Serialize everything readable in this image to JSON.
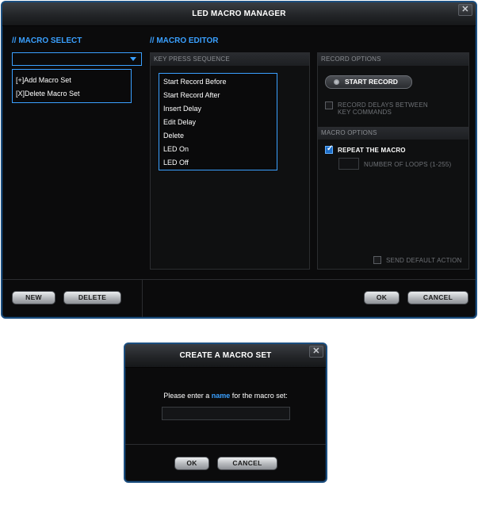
{
  "main_window": {
    "title": "LED MACRO MANAGER",
    "close_glyph": "✕",
    "macro_select": {
      "heading": "// MACRO SELECT",
      "dropdown_value": "",
      "menu_items": [
        "[+]Add Macro Set",
        "[X]Delete Macro Set"
      ]
    },
    "macro_editor": {
      "heading": "// MACRO EDITOR",
      "key_press_header": "KEY PRESS SEQUENCE",
      "sequence_items": [
        "Start Record Before",
        "Start Record After",
        "Insert Delay",
        "Edit Delay",
        "Delete",
        "LED On",
        "LED Off"
      ]
    },
    "record_options": {
      "header": "RECORD OPTIONS",
      "start_record_label": "START RECORD",
      "record_delays_line1": "RECORD DELAYS BETWEEN",
      "record_delays_line2": "KEY COMMANDS",
      "record_delays_checked": false
    },
    "macro_options": {
      "header": "MACRO OPTIONS",
      "repeat_label": "REPEAT THE MACRO",
      "repeat_checked": true,
      "loops_label": "NUMBER OF LOOPS (1-255)",
      "loops_value": "",
      "send_default_label": "SEND DEFAULT ACTION",
      "send_default_checked": false
    },
    "footer": {
      "new_label": "NEW",
      "delete_label": "DELETE",
      "ok_label": "OK",
      "cancel_label": "CANCEL"
    }
  },
  "dialog": {
    "title": "CREATE A MACRO SET",
    "close_glyph": "✕",
    "prompt_before": "Please enter a ",
    "prompt_highlight": "name",
    "prompt_after": " for the macro set:",
    "name_value": "",
    "ok_label": "OK",
    "cancel_label": "CANCEL"
  },
  "colors": {
    "accent": "#3aa0ff",
    "border": "#1c4f80",
    "background": "#0b0b0c"
  }
}
